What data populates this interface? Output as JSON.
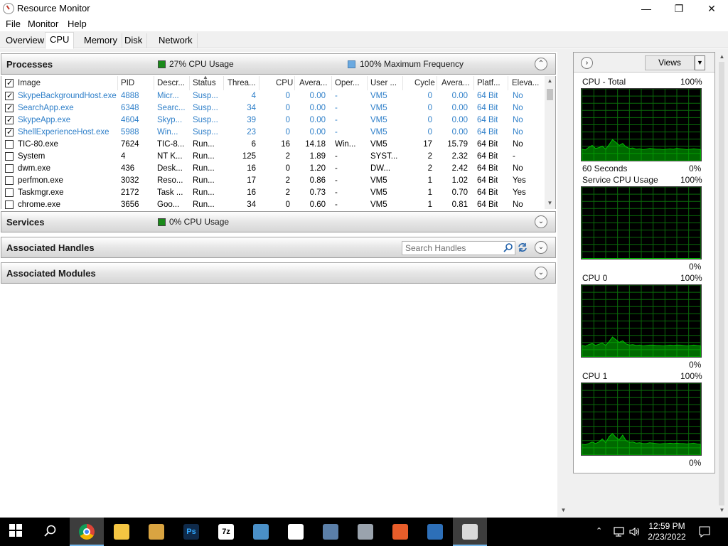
{
  "window": {
    "title": "Resource Monitor",
    "minimize": "—",
    "maximize": "❐",
    "close": "✕"
  },
  "menu": [
    "File",
    "Monitor",
    "Help"
  ],
  "tabs": [
    "Overview",
    "CPU",
    "Memory",
    "Disk",
    "Network"
  ],
  "active_tab": "CPU",
  "processes": {
    "title": "Processes",
    "cpu_usage": "27% CPU Usage",
    "max_freq": "100% Maximum Frequency",
    "columns": [
      "Image",
      "PID",
      "Descr...",
      "Status",
      "Threa...",
      "CPU",
      "Avera...",
      "Oper...",
      "User ...",
      "Cycle",
      "Avera...",
      "Platf...",
      "Eleva..."
    ],
    "rows": [
      {
        "checked": true,
        "image": "SkypeBackgroundHost.exe",
        "pid": "4888",
        "desc": "Micr...",
        "status": "Susp...",
        "threads": "4",
        "cpu": "0",
        "avg": "0.00",
        "os": "-",
        "user": "VM5",
        "cycle": "0",
        "avg2": "0.00",
        "platform": "64 Bit",
        "elevated": "No"
      },
      {
        "checked": true,
        "image": "SearchApp.exe",
        "pid": "6348",
        "desc": "Searc...",
        "status": "Susp...",
        "threads": "34",
        "cpu": "0",
        "avg": "0.00",
        "os": "-",
        "user": "VM5",
        "cycle": "0",
        "avg2": "0.00",
        "platform": "64 Bit",
        "elevated": "No"
      },
      {
        "checked": true,
        "image": "SkypeApp.exe",
        "pid": "4604",
        "desc": "Skyp...",
        "status": "Susp...",
        "threads": "39",
        "cpu": "0",
        "avg": "0.00",
        "os": "-",
        "user": "VM5",
        "cycle": "0",
        "avg2": "0.00",
        "platform": "64 Bit",
        "elevated": "No"
      },
      {
        "checked": true,
        "image": "ShellExperienceHost.exe",
        "pid": "5988",
        "desc": "Win...",
        "status": "Susp...",
        "threads": "23",
        "cpu": "0",
        "avg": "0.00",
        "os": "-",
        "user": "VM5",
        "cycle": "0",
        "avg2": "0.00",
        "platform": "64 Bit",
        "elevated": "No"
      },
      {
        "checked": false,
        "image": "TIC-80.exe",
        "pid": "7624",
        "desc": "TIC-8...",
        "status": "Run...",
        "threads": "6",
        "cpu": "16",
        "avg": "14.18",
        "os": "Win...",
        "user": "VM5",
        "cycle": "17",
        "avg2": "15.79",
        "platform": "64 Bit",
        "elevated": "No"
      },
      {
        "checked": false,
        "image": "System",
        "pid": "4",
        "desc": "NT K...",
        "status": "Run...",
        "threads": "125",
        "cpu": "2",
        "avg": "1.89",
        "os": "-",
        "user": "SYST...",
        "cycle": "2",
        "avg2": "2.32",
        "platform": "64 Bit",
        "elevated": "-"
      },
      {
        "checked": false,
        "image": "dwm.exe",
        "pid": "436",
        "desc": "Desk...",
        "status": "Run...",
        "threads": "16",
        "cpu": "0",
        "avg": "1.20",
        "os": "-",
        "user": "DW...",
        "cycle": "2",
        "avg2": "2.42",
        "platform": "64 Bit",
        "elevated": "No"
      },
      {
        "checked": false,
        "image": "perfmon.exe",
        "pid": "3032",
        "desc": "Reso...",
        "status": "Run...",
        "threads": "17",
        "cpu": "2",
        "avg": "0.86",
        "os": "-",
        "user": "VM5",
        "cycle": "1",
        "avg2": "1.02",
        "platform": "64 Bit",
        "elevated": "Yes"
      },
      {
        "checked": false,
        "image": "Taskmgr.exe",
        "pid": "2172",
        "desc": "Task ...",
        "status": "Run...",
        "threads": "16",
        "cpu": "2",
        "avg": "0.73",
        "os": "-",
        "user": "VM5",
        "cycle": "1",
        "avg2": "0.70",
        "platform": "64 Bit",
        "elevated": "Yes"
      },
      {
        "checked": false,
        "image": "chrome.exe",
        "pid": "3656",
        "desc": "Goo...",
        "status": "Run...",
        "threads": "34",
        "cpu": "0",
        "avg": "0.60",
        "os": "-",
        "user": "VM5",
        "cycle": "1",
        "avg2": "0.81",
        "platform": "64 Bit",
        "elevated": "No"
      }
    ]
  },
  "services": {
    "title": "Services",
    "cpu_usage": "0% CPU Usage"
  },
  "handles": {
    "title": "Associated Handles",
    "search_placeholder": "Search Handles"
  },
  "modules": {
    "title": "Associated Modules"
  },
  "right_pane": {
    "views_label": "Views",
    "graphs": [
      {
        "title": "CPU - Total",
        "max": "100%",
        "bottom_left": "60 Seconds",
        "bottom_right": "0%"
      },
      {
        "title": "Service CPU Usage",
        "max": "100%",
        "bottom_left": "",
        "bottom_right": "0%"
      },
      {
        "title": "CPU 0",
        "max": "100%",
        "bottom_left": "",
        "bottom_right": "0%"
      },
      {
        "title": "CPU 1",
        "max": "100%",
        "bottom_left": "",
        "bottom_right": "0%"
      }
    ]
  },
  "taskbar": {
    "apps": [
      "start-icon",
      "search-icon",
      "chrome-icon",
      "file-explorer-icon",
      "paint-icon",
      "photoshop-icon",
      "7zip-icon",
      "monitor-app-icon",
      "photos-icon",
      "virtualbox-icon",
      "network-drive-icon",
      "color-app-icon",
      "remote-desktop-icon",
      "resource-monitor-icon"
    ],
    "time": "12:59 PM",
    "date": "2/23/2022"
  },
  "colors": {
    "accent": "#2e7fc9",
    "graph_green": "#00c000",
    "graph_bg": "#000000",
    "grid": "#0a6b0a",
    "cpu_badge": "#1a8a1a",
    "freq_badge": "#6aa9e0"
  }
}
